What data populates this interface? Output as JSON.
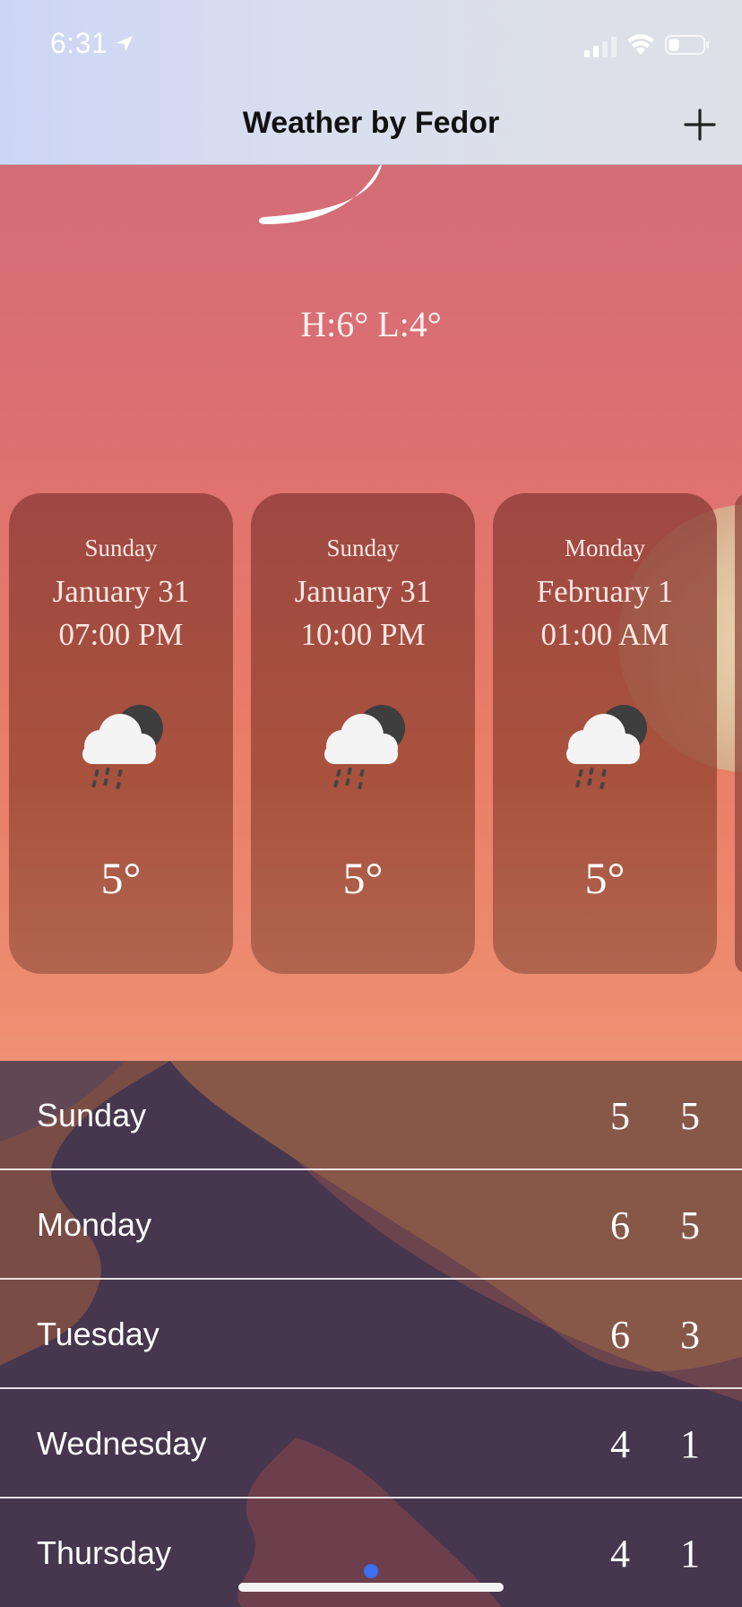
{
  "status_bar": {
    "time": "6:31",
    "icons": [
      "location-arrow-icon",
      "cellular-signal-icon",
      "wifi-icon",
      "battery-icon"
    ]
  },
  "nav": {
    "title": "Weather by Fedor",
    "add_icon": "plus-icon"
  },
  "current": {
    "high_low": "H:6° L:4°",
    "icon": "crescent-moon-icon"
  },
  "hourly": [
    {
      "day": "Sunday",
      "date": "January 31",
      "time": "07:00 PM",
      "icon": "night-rain-cloud-icon",
      "temp": "5°"
    },
    {
      "day": "Sunday",
      "date": "January 31",
      "time": "10:00 PM",
      "icon": "night-rain-cloud-icon",
      "temp": "5°"
    },
    {
      "day": "Monday",
      "date": "February 1",
      "time": "01:00 AM",
      "icon": "night-rain-cloud-icon",
      "temp": "5°"
    }
  ],
  "daily": [
    {
      "day": "Sunday",
      "high": "5",
      "low": "5"
    },
    {
      "day": "Monday",
      "high": "6",
      "low": "5"
    },
    {
      "day": "Tuesday",
      "high": "6",
      "low": "3"
    },
    {
      "day": "Wednesday",
      "high": "4",
      "low": "1"
    },
    {
      "day": "Thursday",
      "high": "4",
      "low": "1"
    }
  ],
  "colors": {
    "sky_top": "#cc6b7a",
    "sky_bottom": "#f2977a",
    "card": "#8c3c37",
    "dune_dark": "#3c3350",
    "page_dot": "#3d6ff0"
  }
}
